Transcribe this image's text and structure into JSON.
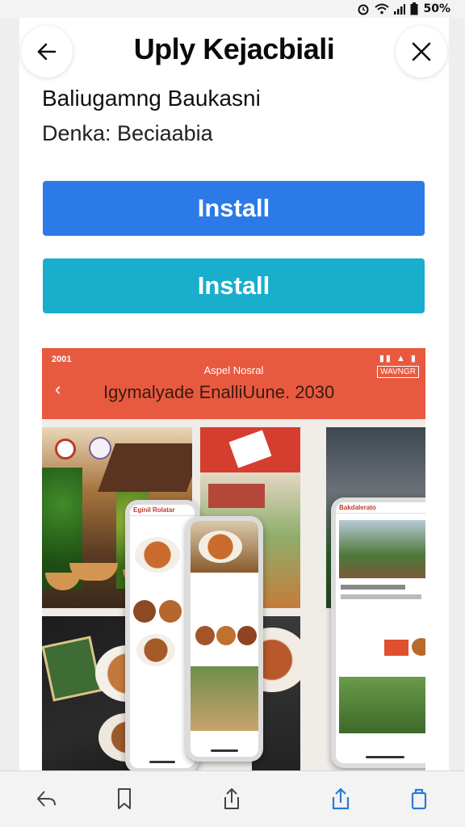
{
  "status_bar": {
    "battery": "50%"
  },
  "header": {
    "title": "Uply Kejacbiali",
    "back_icon": "arrow-left-icon",
    "close_icon": "close-icon"
  },
  "app": {
    "name": "Baliugamng Baukasni",
    "developer": "Denka: Beciaabia"
  },
  "buttons": {
    "install_primary": "Install",
    "install_secondary": "Install"
  },
  "gallery": {
    "status_time": "2001",
    "label": "Aspel Nosral",
    "badge": "WAVNGR",
    "heading": "Igymalyade EnalliUune. 2030",
    "phone_1_title": "Eginil Rolatar",
    "phone_3_title": "Bakdalerato"
  },
  "toolbar": {
    "icons": [
      "share-arrow-icon",
      "bookmark-icon",
      "share-icon",
      "upload-icon",
      "tabs-icon"
    ]
  },
  "colors": {
    "install_primary": "#2b7ae8",
    "install_secondary": "#1aaecd",
    "gallery_bar": "#e85a40",
    "toolbar_accent": "#2a7ad8"
  }
}
